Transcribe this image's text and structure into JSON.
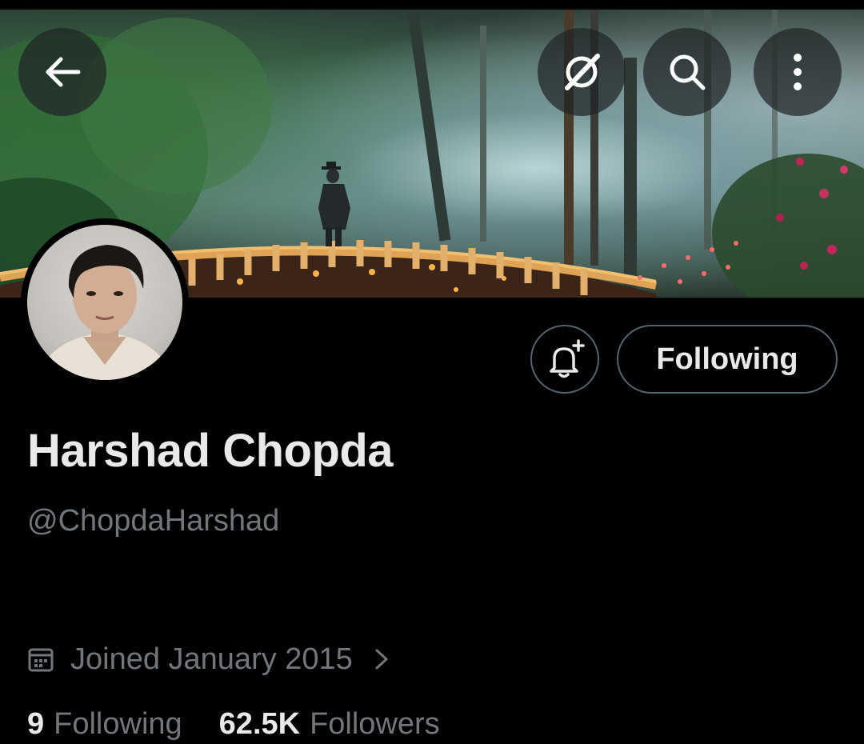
{
  "profile": {
    "display_name": "Harshad Chopda",
    "handle": "@ChopdaHarshad",
    "joined": "Joined January 2015",
    "following_count": "9",
    "following_label": "Following",
    "followers_count": "62.5K",
    "followers_label": "Followers"
  },
  "actions": {
    "follow_state_label": "Following"
  },
  "icons": {
    "back": "arrow-left-icon",
    "grok": "grok-icon",
    "search": "search-icon",
    "more": "more-vertical-icon",
    "notify": "bell-plus-icon",
    "calendar": "calendar-icon",
    "chevron": "chevron-right-icon"
  },
  "colors": {
    "background": "#000000",
    "primary_text": "#e7e9ea",
    "secondary_text": "#71767b",
    "border": "#536471"
  }
}
